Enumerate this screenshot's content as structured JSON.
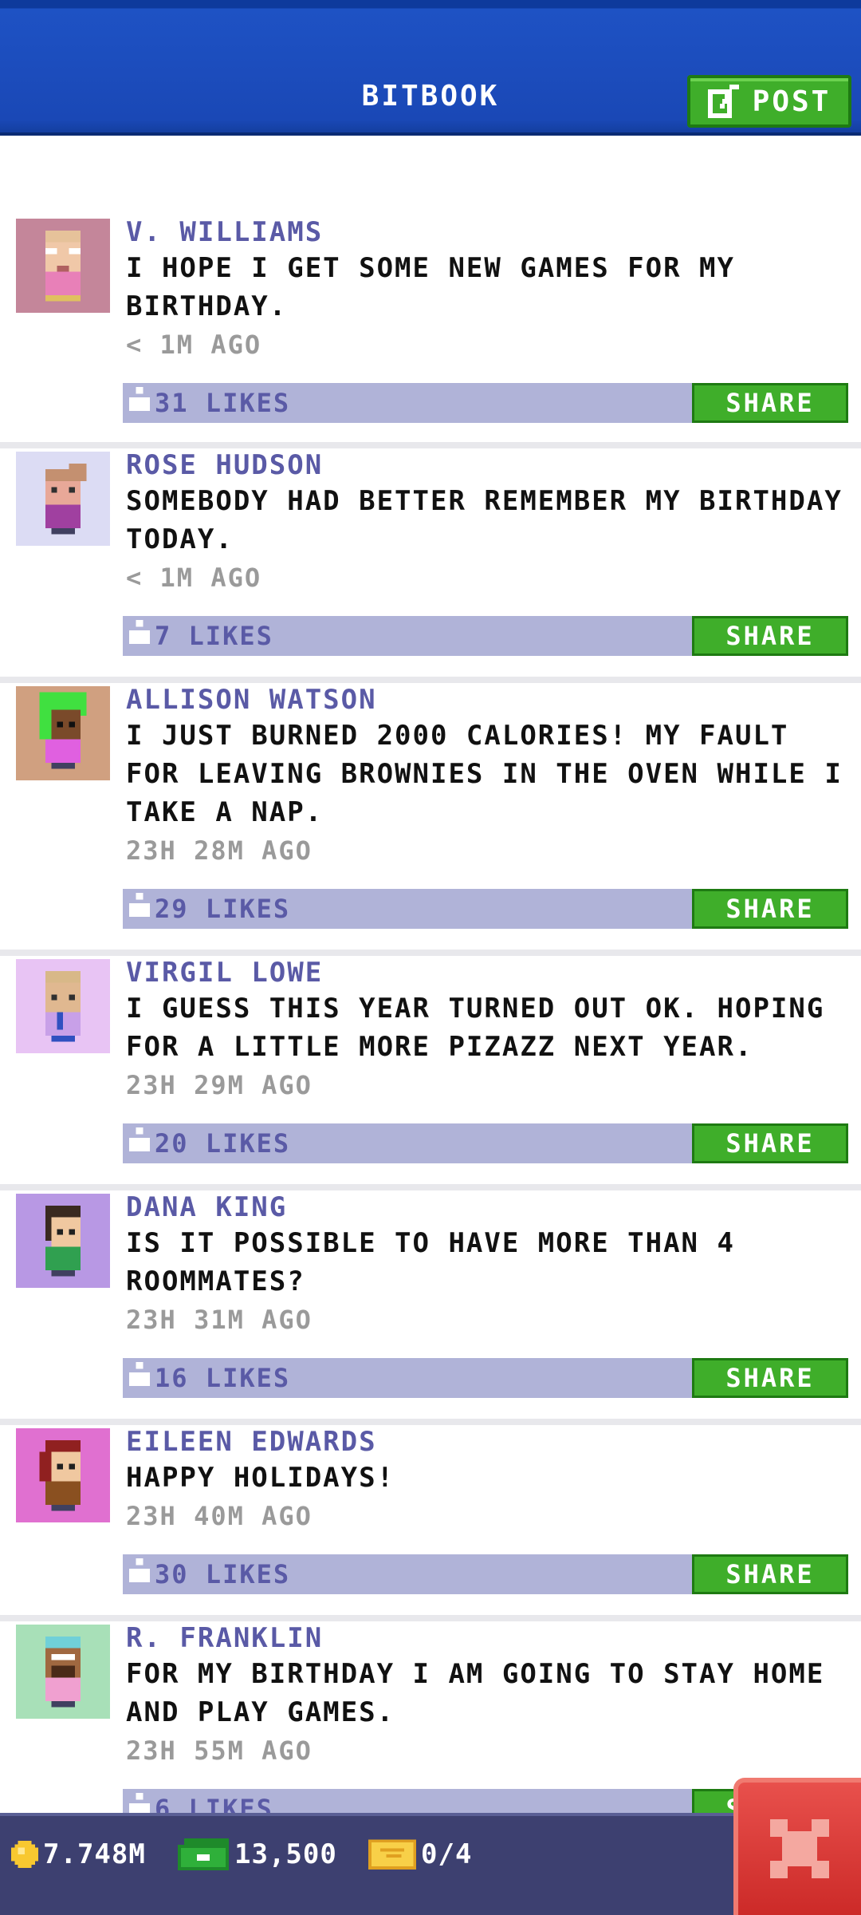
{
  "header": {
    "title": "BITBOOK",
    "post_label": "POST"
  },
  "posts": [
    {
      "author": "V. WILLIAMS",
      "message": "I HOPE I GET SOME NEW GAMES FOR MY BIRTHDAY.",
      "time": "< 1M AGO",
      "likes": "31 LIKES",
      "share": "SHARE"
    },
    {
      "author": "ROSE HUDSON",
      "message": "SOMEBODY HAD BETTER REMEMBER MY BIRTHDAY TODAY.",
      "time": "< 1M AGO",
      "likes": "7 LIKES",
      "share": "SHARE"
    },
    {
      "author": "ALLISON WATSON",
      "message": "I JUST BURNED 2000 CALORIES! MY FAULT FOR LEAVING BROWNIES IN THE OVEN WHILE I TAKE A NAP.",
      "time": "23H 28M AGO",
      "likes": "29 LIKES",
      "share": "SHARE"
    },
    {
      "author": "VIRGIL LOWE",
      "message": "I GUESS THIS YEAR TURNED OUT OK. HOPING FOR A LITTLE MORE PIZAZZ NEXT YEAR.",
      "time": "23H 29M AGO",
      "likes": "20 LIKES",
      "share": "SHARE"
    },
    {
      "author": "DANA KING",
      "message": "IS IT POSSIBLE TO HAVE MORE THAN 4 ROOMMATES?",
      "time": "23H 31M AGO",
      "likes": "16 LIKES",
      "share": "SHARE"
    },
    {
      "author": "EILEEN EDWARDS",
      "message": "HAPPY HOLIDAYS!",
      "time": "23H 40M AGO",
      "likes": "30 LIKES",
      "share": "SHARE"
    },
    {
      "author": "R. FRANKLIN",
      "message": "FOR MY BIRTHDAY I AM GOING TO STAY HOME AND PLAY GAMES.",
      "time": "23H 55M AGO",
      "likes": "6 LIKES",
      "share": "SHARE"
    }
  ],
  "footer": {
    "coins": "7.748M",
    "bux": "13,500",
    "tickets": "0/4"
  },
  "icons": {
    "post": "edit-icon",
    "like": "thumbs-up-icon",
    "coins": "coin-icon",
    "bux": "bux-icon",
    "tickets": "ticket-icon",
    "close": "close-icon"
  },
  "colors": {
    "header": "#1a48b6",
    "accent_green": "#3fae2a",
    "author": "#5a5aa6",
    "action_bar": "#b0b3d8",
    "footer": "#3d4070",
    "close": "#d83a36"
  }
}
